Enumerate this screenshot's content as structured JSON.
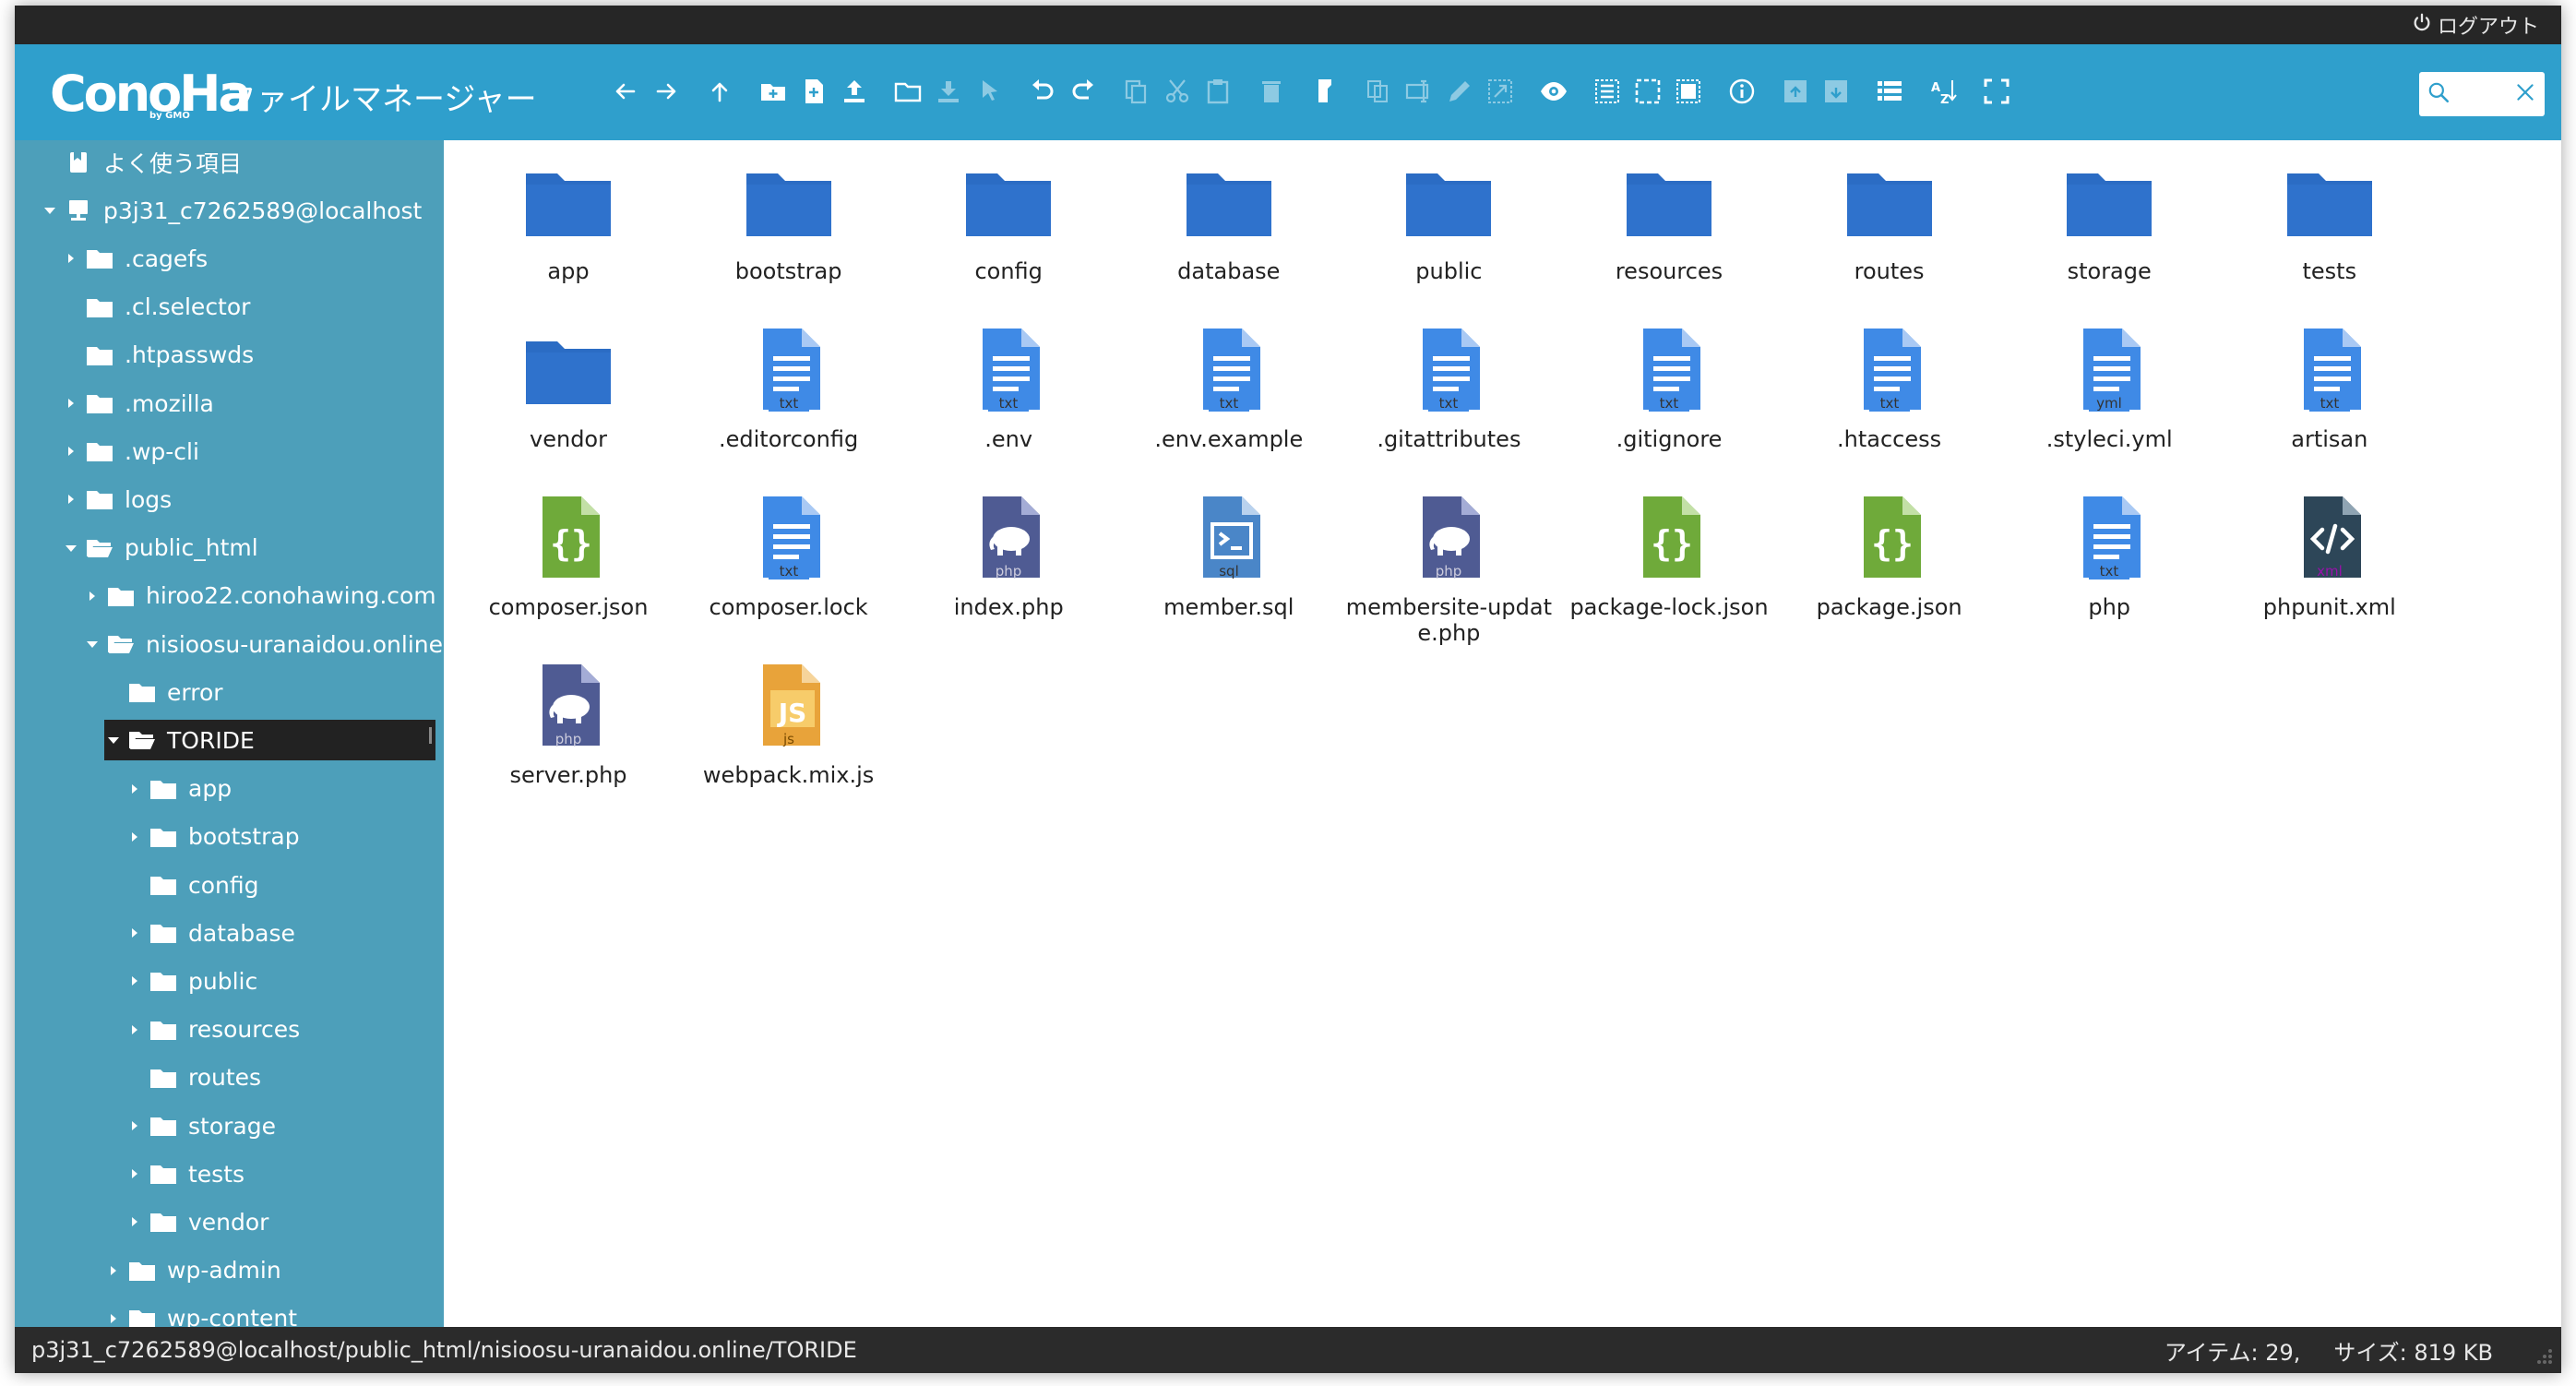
{
  "topbar": {
    "logout_label": "ログアウト"
  },
  "header": {
    "logo_text": "ConoHa",
    "logo_sub": "by GMO",
    "title": "ファイルマネージャー"
  },
  "toolbar": {
    "tools": [
      "back-icon",
      "forward-icon",
      "up-icon",
      "new-folder-icon",
      "new-file-icon",
      "upload-icon",
      "open-icon",
      "download-icon",
      "getfile-icon",
      "undo-icon",
      "redo-icon",
      "copy-icon",
      "cut-icon",
      "paste-icon",
      "delete-icon",
      "empty-icon",
      "duplicate-icon",
      "rename-icon",
      "edit-icon",
      "resize-icon",
      "preview-icon",
      "select-all-icon",
      "select-none-icon",
      "invert-select-icon",
      "info-icon",
      "extract-icon",
      "archive-icon",
      "view-list-icon",
      "sort-icon",
      "fullscreen-icon"
    ]
  },
  "search": {
    "placeholder": ""
  },
  "sidebar": {
    "favorites_label": "よく使う項目",
    "root_label": "p3j31_c7262589@localhost",
    "items": [
      {
        "label": ".cagefs"
      },
      {
        "label": ".cl.selector"
      },
      {
        "label": ".htpasswds"
      },
      {
        "label": ".mozilla"
      },
      {
        "label": ".wp-cli"
      },
      {
        "label": "logs"
      },
      {
        "label": "public_html"
      },
      {
        "label": "hiroo22.conohawing.com"
      },
      {
        "label": "nisioosu-uranaidou.online"
      },
      {
        "label": "error"
      },
      {
        "label": "TORIDE"
      },
      {
        "label": "app"
      },
      {
        "label": "bootstrap"
      },
      {
        "label": "config"
      },
      {
        "label": "database"
      },
      {
        "label": "public"
      },
      {
        "label": "resources"
      },
      {
        "label": "routes"
      },
      {
        "label": "storage"
      },
      {
        "label": "tests"
      },
      {
        "label": "vendor"
      },
      {
        "label": "wp-admin"
      },
      {
        "label": "wp-content"
      }
    ]
  },
  "files": [
    {
      "name": "app",
      "kind": "folder"
    },
    {
      "name": "bootstrap",
      "kind": "folder"
    },
    {
      "name": "config",
      "kind": "folder"
    },
    {
      "name": "database",
      "kind": "folder"
    },
    {
      "name": "public",
      "kind": "folder"
    },
    {
      "name": "resources",
      "kind": "folder"
    },
    {
      "name": "routes",
      "kind": "folder"
    },
    {
      "name": "storage",
      "kind": "folder"
    },
    {
      "name": "tests",
      "kind": "folder"
    },
    {
      "name": "vendor",
      "kind": "folder"
    },
    {
      "name": ".editorconfig",
      "kind": "txt",
      "tag": "txt"
    },
    {
      "name": ".env",
      "kind": "txt",
      "tag": "txt"
    },
    {
      "name": ".env.example",
      "kind": "txt",
      "tag": "txt"
    },
    {
      "name": ".gitattributes",
      "kind": "txt",
      "tag": "txt"
    },
    {
      "name": ".gitignore",
      "kind": "txt",
      "tag": "txt"
    },
    {
      "name": ".htaccess",
      "kind": "txt",
      "tag": "txt"
    },
    {
      "name": ".styleci.yml",
      "kind": "txt",
      "tag": "yml"
    },
    {
      "name": "artisan",
      "kind": "txt",
      "tag": "txt"
    },
    {
      "name": "composer.json",
      "kind": "json"
    },
    {
      "name": "composer.lock",
      "kind": "txt",
      "tag": "txt"
    },
    {
      "name": "index.php",
      "kind": "php",
      "tag": "php"
    },
    {
      "name": "member.sql",
      "kind": "sql",
      "tag": "sql"
    },
    {
      "name": "membersite-update.php",
      "kind": "php",
      "tag": "php"
    },
    {
      "name": "package-lock.json",
      "kind": "json"
    },
    {
      "name": "package.json",
      "kind": "json"
    },
    {
      "name": "php",
      "kind": "txt",
      "tag": "txt"
    },
    {
      "name": "phpunit.xml",
      "kind": "xml",
      "tag": "xml"
    },
    {
      "name": "server.php",
      "kind": "php",
      "tag": "php"
    },
    {
      "name": "webpack.mix.js",
      "kind": "js",
      "tag": "js"
    }
  ],
  "status": {
    "path": "p3j31_c7262589@localhost/public_html/nisioosu-uranaidou.online/TORIDE",
    "items": "アイテム: 29,",
    "size": "サイズ: 819 KB"
  },
  "colors": {
    "toolbar": "#2f9fcc",
    "sidebar": "#4d9fba",
    "folder": "#2b6cc4",
    "json": "#6faa3a",
    "php": "#4f5b93",
    "js": "#e8a33a"
  }
}
